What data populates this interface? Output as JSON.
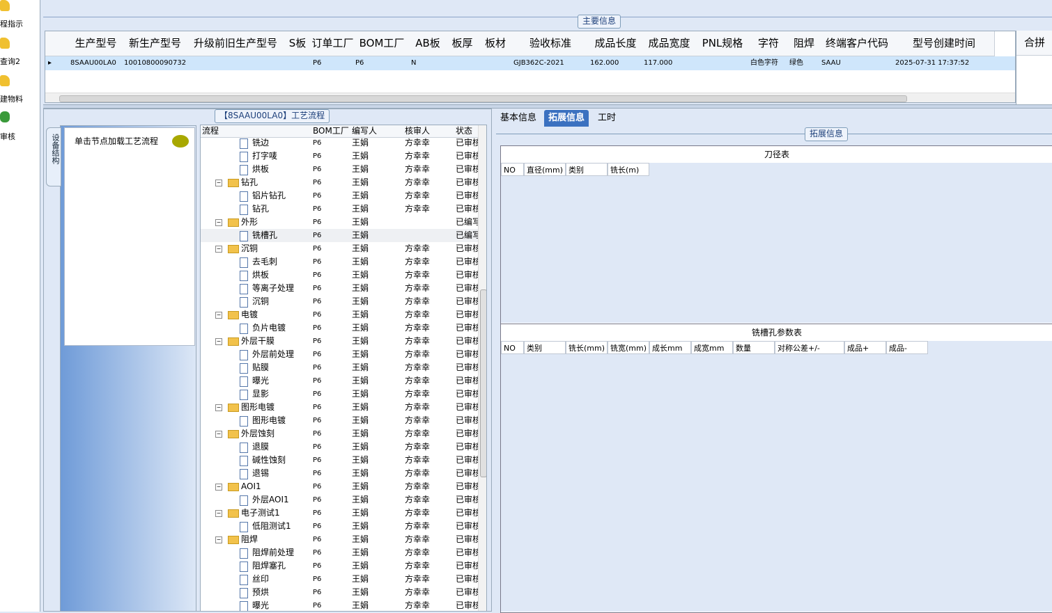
{
  "left_nav": [
    {
      "label": "程指示",
      "icon": "folder-edit-icon"
    },
    {
      "label": "查询2",
      "icon": "folder-edit-icon"
    },
    {
      "label": "建物料",
      "icon": "folder-edit-icon"
    },
    {
      "label": "审核",
      "icon": "user-icon"
    }
  ],
  "main_info": {
    "legend": "主要信息",
    "columns": [
      "生产型号",
      "新生产型号",
      "升级前旧生产型号",
      "S板",
      "订单工厂",
      "BOM工厂",
      "AB板",
      "板厚",
      "板材",
      "验收标准",
      "成品长度",
      "成品宽度",
      "PNL规格",
      "字符",
      "阻焊",
      "终端客户代码",
      "型号创建时间"
    ],
    "row": [
      "8SAAU00LA0",
      "10010800090732",
      "",
      "",
      "P6",
      "P6",
      "N",
      "",
      "",
      "GJB362C-2021",
      "162.000",
      "117.000",
      "",
      "白色字符",
      "绿色",
      "SAAU",
      "2025-07-31 17:37:52"
    ],
    "right_header": "合拼"
  },
  "process": {
    "title": "【8SAAU00LA0】工艺流程",
    "vertical_tab": "设备结构",
    "hint": "单击节点加载工艺流程",
    "columns": [
      "流程",
      "BOM工厂",
      "编写人",
      "核审人",
      "状态"
    ],
    "rows": [
      {
        "name": "铣边",
        "level": 2,
        "bom": "P6",
        "writer": "王娟",
        "reviewer": "方幸幸",
        "status": "已审核"
      },
      {
        "name": "打字唛",
        "level": 2,
        "bom": "P6",
        "writer": "王娟",
        "reviewer": "方幸幸",
        "status": "已审核"
      },
      {
        "name": "烘板",
        "level": 2,
        "bom": "P6",
        "writer": "王娟",
        "reviewer": "方幸幸",
        "status": "已审核"
      },
      {
        "name": "钻孔",
        "level": 1,
        "bom": "P6",
        "writer": "王娟",
        "reviewer": "方幸幸",
        "status": "已审核"
      },
      {
        "name": "铝片钻孔",
        "level": 2,
        "bom": "P6",
        "writer": "王娟",
        "reviewer": "方幸幸",
        "status": "已审核"
      },
      {
        "name": "钻孔",
        "level": 2,
        "bom": "P6",
        "writer": "王娟",
        "reviewer": "方幸幸",
        "status": "已审核"
      },
      {
        "name": "外形",
        "level": 1,
        "bom": "P6",
        "writer": "王娟",
        "reviewer": "",
        "status": "已编写"
      },
      {
        "name": "铣槽孔",
        "level": 2,
        "bom": "P6",
        "writer": "王娟",
        "reviewer": "",
        "status": "已编写",
        "selected": true
      },
      {
        "name": "沉铜",
        "level": 1,
        "bom": "P6",
        "writer": "王娟",
        "reviewer": "方幸幸",
        "status": "已审核"
      },
      {
        "name": "去毛刺",
        "level": 2,
        "bom": "P6",
        "writer": "王娟",
        "reviewer": "方幸幸",
        "status": "已审核"
      },
      {
        "name": "烘板",
        "level": 2,
        "bom": "P6",
        "writer": "王娟",
        "reviewer": "方幸幸",
        "status": "已审核"
      },
      {
        "name": "等离子处理",
        "level": 2,
        "bom": "P6",
        "writer": "王娟",
        "reviewer": "方幸幸",
        "status": "已审核"
      },
      {
        "name": "沉铜",
        "level": 2,
        "bom": "P6",
        "writer": "王娟",
        "reviewer": "方幸幸",
        "status": "已审核"
      },
      {
        "name": "电镀",
        "level": 1,
        "bom": "P6",
        "writer": "王娟",
        "reviewer": "方幸幸",
        "status": "已审核"
      },
      {
        "name": "负片电镀",
        "level": 2,
        "bom": "P6",
        "writer": "王娟",
        "reviewer": "方幸幸",
        "status": "已审核"
      },
      {
        "name": "外层干膜",
        "level": 1,
        "bom": "P6",
        "writer": "王娟",
        "reviewer": "方幸幸",
        "status": "已审核"
      },
      {
        "name": "外层前处理",
        "level": 2,
        "bom": "P6",
        "writer": "王娟",
        "reviewer": "方幸幸",
        "status": "已审核"
      },
      {
        "name": "贴膜",
        "level": 2,
        "bom": "P6",
        "writer": "王娟",
        "reviewer": "方幸幸",
        "status": "已审核"
      },
      {
        "name": "曝光",
        "level": 2,
        "bom": "P6",
        "writer": "王娟",
        "reviewer": "方幸幸",
        "status": "已审核"
      },
      {
        "name": "显影",
        "level": 2,
        "bom": "P6",
        "writer": "王娟",
        "reviewer": "方幸幸",
        "status": "已审核"
      },
      {
        "name": "图形电镀",
        "level": 1,
        "bom": "P6",
        "writer": "王娟",
        "reviewer": "方幸幸",
        "status": "已审核"
      },
      {
        "name": "图形电镀",
        "level": 2,
        "bom": "P6",
        "writer": "王娟",
        "reviewer": "方幸幸",
        "status": "已审核"
      },
      {
        "name": "外层蚀刻",
        "level": 1,
        "bom": "P6",
        "writer": "王娟",
        "reviewer": "方幸幸",
        "status": "已审核"
      },
      {
        "name": "退膜",
        "level": 2,
        "bom": "P6",
        "writer": "王娟",
        "reviewer": "方幸幸",
        "status": "已审核"
      },
      {
        "name": "碱性蚀刻",
        "level": 2,
        "bom": "P6",
        "writer": "王娟",
        "reviewer": "方幸幸",
        "status": "已审核"
      },
      {
        "name": "退锡",
        "level": 2,
        "bom": "P6",
        "writer": "王娟",
        "reviewer": "方幸幸",
        "status": "已审核"
      },
      {
        "name": "AOI1",
        "level": 1,
        "bom": "P6",
        "writer": "王娟",
        "reviewer": "方幸幸",
        "status": "已审核"
      },
      {
        "name": "外层AOI1",
        "level": 2,
        "bom": "P6",
        "writer": "王娟",
        "reviewer": "方幸幸",
        "status": "已审核"
      },
      {
        "name": "电子测试1",
        "level": 1,
        "bom": "P6",
        "writer": "王娟",
        "reviewer": "方幸幸",
        "status": "已审核"
      },
      {
        "name": "低阻测试1",
        "level": 2,
        "bom": "P6",
        "writer": "王娟",
        "reviewer": "方幸幸",
        "status": "已审核"
      },
      {
        "name": "阻焊",
        "level": 1,
        "bom": "P6",
        "writer": "王娟",
        "reviewer": "方幸幸",
        "status": "已审核"
      },
      {
        "name": "阻焊前处理",
        "level": 2,
        "bom": "P6",
        "writer": "王娟",
        "reviewer": "方幸幸",
        "status": "已审核"
      },
      {
        "name": "阻焊塞孔",
        "level": 2,
        "bom": "P6",
        "writer": "王娟",
        "reviewer": "方幸幸",
        "status": "已审核"
      },
      {
        "name": "丝印",
        "level": 2,
        "bom": "P6",
        "writer": "王娟",
        "reviewer": "方幸幸",
        "status": "已审核"
      },
      {
        "name": "预烘",
        "level": 2,
        "bom": "P6",
        "writer": "王娟",
        "reviewer": "方幸幸",
        "status": "已审核"
      },
      {
        "name": "曝光",
        "level": 2,
        "bom": "P6",
        "writer": "王娟",
        "reviewer": "方幸幸",
        "status": "已审核"
      }
    ]
  },
  "tabs": [
    "基本信息",
    "拓展信息",
    "工时"
  ],
  "active_tab": "拓展信息",
  "ext": {
    "legend": "拓展信息",
    "table1": {
      "title": "刀径表",
      "columns": [
        "NO",
        "直径(mm)",
        "类别",
        "铣长(m)"
      ]
    },
    "table2": {
      "title": "铣槽孔参数表",
      "columns": [
        "NO",
        "类别",
        "铣长(mm)",
        "铣宽(mm)",
        "成长mm",
        "成宽mm",
        "数量",
        "对称公差+/-",
        "成品+",
        "成品-"
      ]
    }
  },
  "colors": {
    "accent": "#3b71c0",
    "selected_row": "#cfe6fb",
    "panel_bg": "#dfe8f6"
  }
}
